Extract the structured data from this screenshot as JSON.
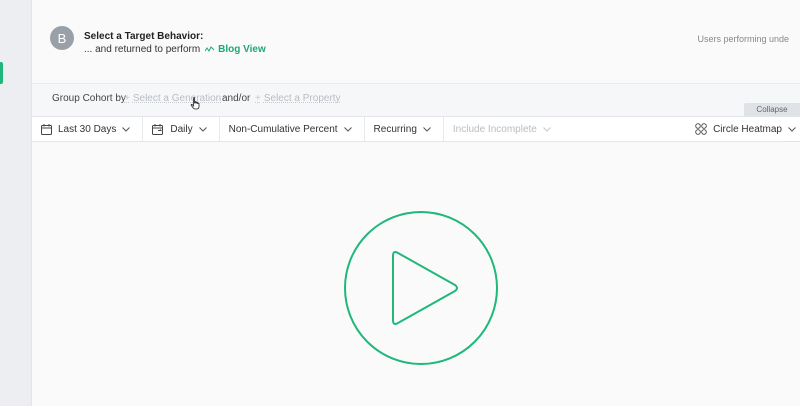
{
  "header": {
    "avatar_letter": "B",
    "title": "Select a Target Behavior:",
    "subtitle_prefix": "... and returned to perform",
    "event_name": "Blog View",
    "users_performing": "Users performing unde"
  },
  "cohort": {
    "label": "Group Cohort by",
    "generation_placeholder": "Select a Generation",
    "and_or": "and/or",
    "property_placeholder": "Select a Property",
    "collapse_label": "Collapse"
  },
  "toolbar": {
    "date_range": "Last 30 Days",
    "interval": "Daily",
    "metric": "Non-Cumulative Percent",
    "retention_type": "Recurring",
    "include_incomplete": "Include Incomplete",
    "view": "Circle Heatmap"
  },
  "colors": {
    "accent": "#1fb87a",
    "disabled_text": "#b9bdc3"
  },
  "icons": {
    "calendar": "calendar-icon",
    "calendar_interval": "calendar-arrow-icon",
    "chevron": "chevron-down-icon",
    "view": "circle-heatmap-icon",
    "play": "play-icon",
    "event": "trend-line-icon",
    "flag": "flag-icon"
  }
}
